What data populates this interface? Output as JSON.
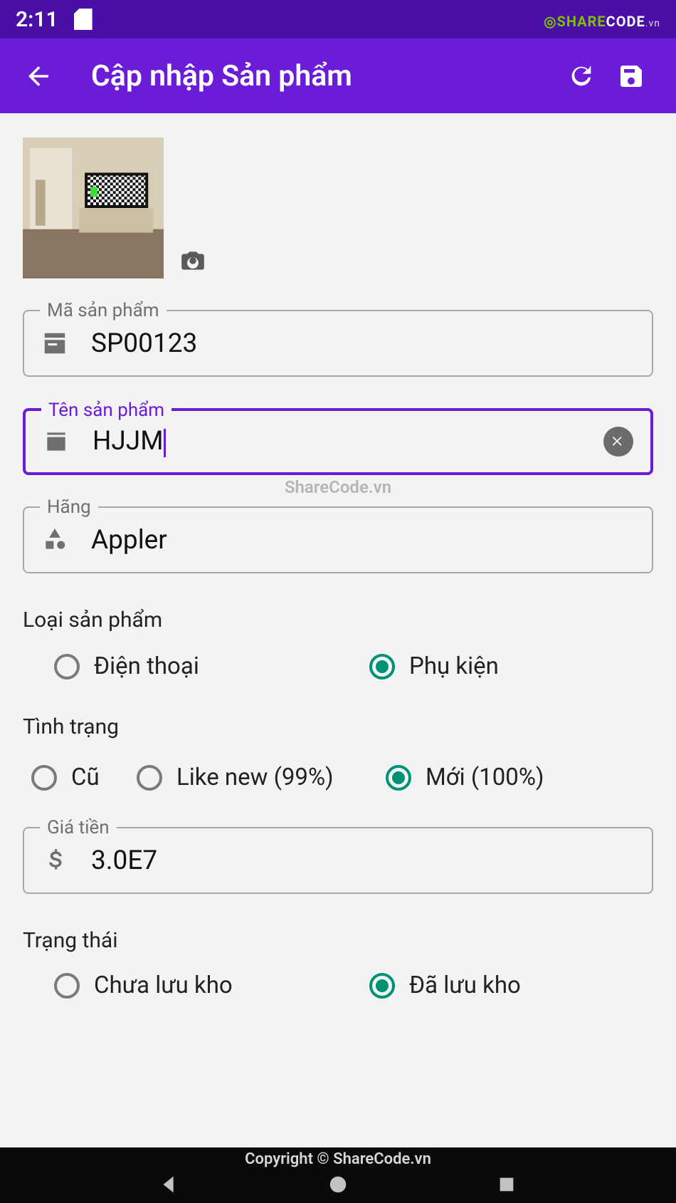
{
  "status_bar": {
    "time": "2:11",
    "logo_share": "SHARE",
    "logo_code": "CODE",
    "logo_vn": ".vn"
  },
  "app_bar": {
    "title": "Cập nhập Sản phẩm"
  },
  "watermark_center": "ShareCode.vn",
  "form": {
    "code": {
      "label": "Mã sản phẩm",
      "value": "SP00123"
    },
    "name": {
      "label": "Tên sản phẩm",
      "value": "HJJM"
    },
    "brand": {
      "label": "Hãng",
      "value": "Appler"
    },
    "category": {
      "label": "Loại sản phẩm",
      "options": [
        {
          "label": "Điện thoại",
          "selected": false
        },
        {
          "label": "Phụ kiện",
          "selected": true
        }
      ]
    },
    "condition": {
      "label": "Tình trạng",
      "options": [
        {
          "label": "Cũ",
          "selected": false
        },
        {
          "label": "Like new (99%)",
          "selected": false
        },
        {
          "label": "Mới (100%)",
          "selected": true
        }
      ]
    },
    "price": {
      "label": "Giá tiền",
      "value": "3.0E7"
    },
    "status": {
      "label": "Trạng thái",
      "options": [
        {
          "label": "Chưa lưu kho",
          "selected": false
        },
        {
          "label": "Đã lưu kho",
          "selected": true
        }
      ]
    }
  },
  "footer": {
    "copyright": "Copyright © ShareCode.vn"
  }
}
